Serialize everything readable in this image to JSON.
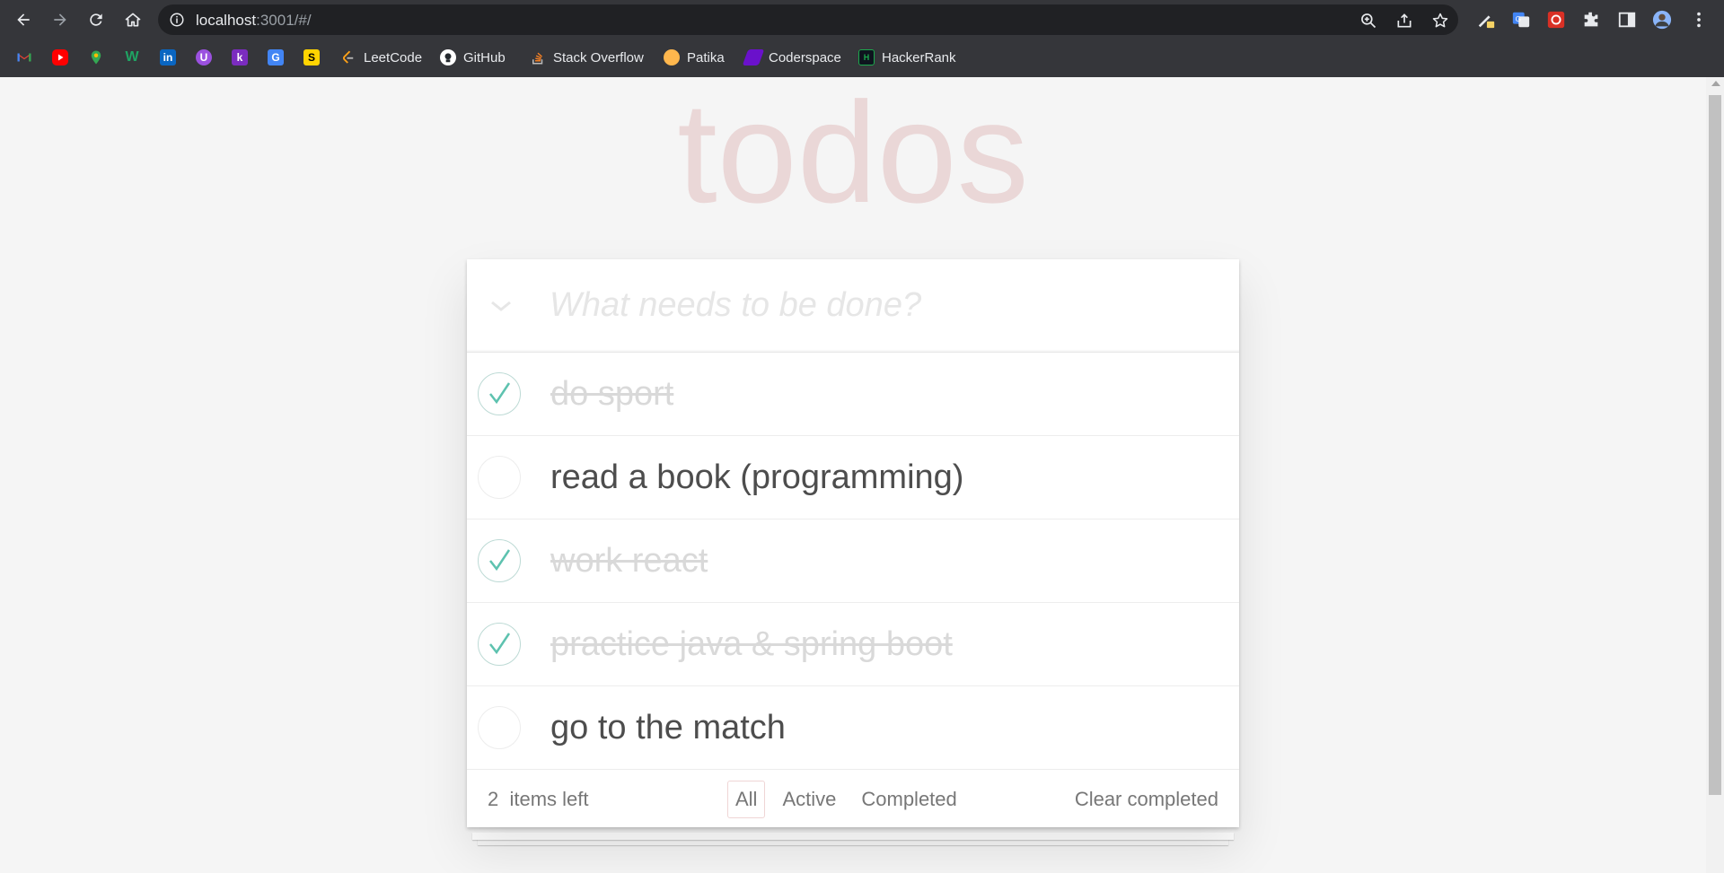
{
  "browser": {
    "url_host": "localhost",
    "url_rest": ":3001/#/",
    "bookmarks": [
      {
        "label": "LeetCode",
        "icon": "leetcode-icon"
      },
      {
        "label": "GitHub",
        "icon": "github-icon"
      },
      {
        "label": "Stack Overflow",
        "icon": "stackoverflow-icon"
      },
      {
        "label": "Patika",
        "icon": "patika-icon"
      },
      {
        "label": "Coderspace",
        "icon": "coderspace-icon"
      },
      {
        "label": "HackerRank",
        "icon": "hackerrank-icon"
      }
    ],
    "icon_only_bookmarks": [
      "gmail-icon",
      "youtube-icon",
      "maps-icon",
      "w-icon",
      "linkedin-icon",
      "u-icon",
      "k-icon",
      "translate-icon",
      "s-icon"
    ]
  },
  "app": {
    "title": "todos",
    "new_todo_placeholder": "What needs to be done?",
    "todos": [
      {
        "text": "do sport",
        "completed": true
      },
      {
        "text": "read a book (programming)",
        "completed": false
      },
      {
        "text": "work react",
        "completed": true
      },
      {
        "text": "practice java & spring boot",
        "completed": true
      },
      {
        "text": "go to the match",
        "completed": false
      }
    ],
    "footer": {
      "count": "2",
      "count_suffix": "items left",
      "filters": [
        "All",
        "Active",
        "Completed"
      ],
      "selected_filter": "All",
      "clear_label": "Clear completed"
    }
  },
  "colors": {
    "accent_check": "#5dc2af",
    "title": "rgba(175,47,47,0.15)"
  }
}
